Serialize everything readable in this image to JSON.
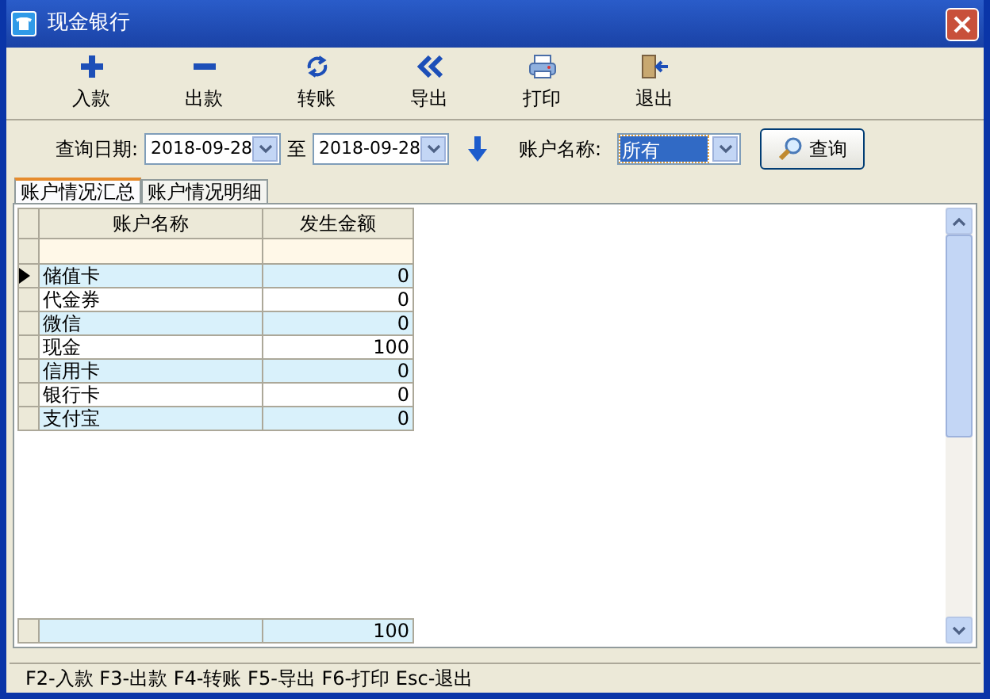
{
  "window": {
    "title": "现金银行"
  },
  "toolbar": [
    {
      "label": "入款",
      "kind": "plus"
    },
    {
      "label": "出款",
      "kind": "minus"
    },
    {
      "label": "转账",
      "kind": "transfer"
    },
    {
      "label": "导出",
      "kind": "export"
    },
    {
      "label": "打印",
      "kind": "print"
    },
    {
      "label": "退出",
      "kind": "exit"
    }
  ],
  "filter": {
    "date_label": "查询日期:",
    "date_from": "2018-09-28",
    "to_label": "至",
    "date_to": "2018-09-28",
    "account_label": "账户名称:",
    "account_value": "所有",
    "query_button": "查询"
  },
  "tabs": [
    {
      "label": "账户情况汇总",
      "selected": true
    },
    {
      "label": "账户情况明细",
      "selected": false
    }
  ],
  "table": {
    "columns": [
      "账户名称",
      "发生金额"
    ],
    "rows": [
      {
        "name": "储值卡",
        "amount": "0",
        "selected": true
      },
      {
        "name": "代金券",
        "amount": "0",
        "selected": false
      },
      {
        "name": "微信",
        "amount": "0",
        "selected": false
      },
      {
        "name": "现金",
        "amount": "100",
        "selected": false
      },
      {
        "name": "信用卡",
        "amount": "0",
        "selected": false
      },
      {
        "name": "银行卡",
        "amount": "0",
        "selected": false
      },
      {
        "name": "支付宝",
        "amount": "0",
        "selected": false
      }
    ],
    "total": "100"
  },
  "status_bar": "F2-入款 F3-出款 F4-转账 F5-导出 F6-打印 Esc-退出"
}
